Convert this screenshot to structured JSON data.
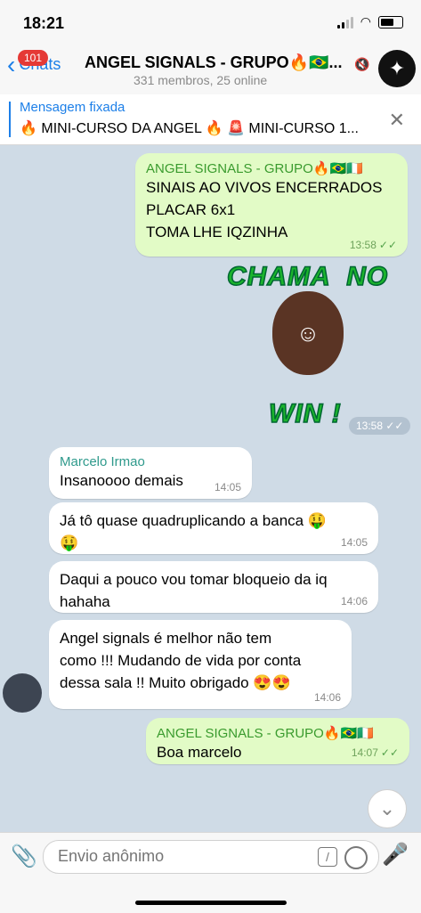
{
  "status_bar": {
    "time": "18:21"
  },
  "header": {
    "back_label": "Chats",
    "unread_badge": "101",
    "title": "ANGEL SIGNALS - GRUPO🔥🇧🇷...",
    "subtitle": "331 membros, 25 online"
  },
  "pinned": {
    "title": "Mensagem fixada",
    "text": "🔥 MINI-CURSO DA ANGEL 🔥 🚨 MINI-CURSO 1..."
  },
  "messages": {
    "m1": {
      "sender": "ANGEL SIGNALS - GRUPO🔥🇧🇷🇮🇪",
      "text": "SINAIS AO VIVOS ENCERRADOS\nPLACAR 6x1\nTOMA LHE IQZINHA",
      "time": "13:58"
    },
    "sticker": {
      "line1": "CHAMA  NO",
      "line2": "WIN !",
      "time": "13:58"
    },
    "m2": {
      "sender": "Marcelo Irmao",
      "text": "Insanoooo demais",
      "time": "14:05"
    },
    "m3": {
      "text": "Já tô quase quadruplicando a banca 🤑\n🤑",
      "time": "14:05"
    },
    "m4": {
      "text": "Daqui a pouco vou tomar bloqueio da iq\nhahaha",
      "time": "14:06"
    },
    "m5": {
      "text": "Angel signals é melhor não tem\ncomo !!! Mudando de vida por conta\ndessa sala !! Muito obrigado 😍😍",
      "time": "14:06"
    },
    "m6": {
      "sender": "ANGEL SIGNALS - GRUPO🔥🇧🇷🇮🇪",
      "text": "Boa marcelo",
      "time": "14:07"
    }
  },
  "composer": {
    "placeholder": "Envio anônimo"
  },
  "colors": {
    "accent": "#1c7fe8",
    "outgoing_bubble": "#e2fbc6",
    "badge": "#e53935"
  },
  "icons": [
    "back-chevron-icon",
    "mute-icon",
    "close-icon",
    "attach-icon",
    "command-icon",
    "timer-icon",
    "mic-icon",
    "chevron-down-icon"
  ]
}
